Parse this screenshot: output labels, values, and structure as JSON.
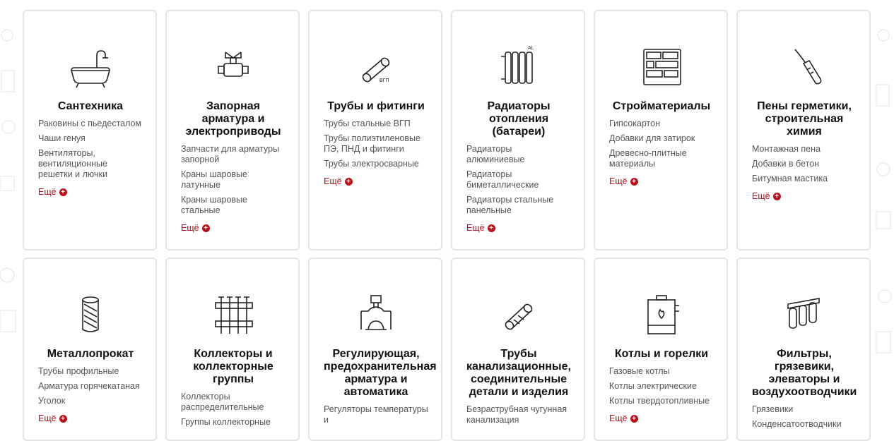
{
  "more_label": "Ещё",
  "accent_color": "#b5121b",
  "cards": [
    {
      "icon": "bathtub-icon",
      "title": "Сантехника",
      "links": [
        "Раковины с пьедесталом",
        "Чаши генуя",
        "Вентиляторы, вентиляционные решетки и лючки"
      ]
    },
    {
      "icon": "valve-icon",
      "title": "Запорная арматура и электроприводы",
      "links": [
        "Запчасти для арматуры запорной",
        "Краны шаровые латунные",
        "Краны шаровые стальные"
      ]
    },
    {
      "icon": "pipe-vgp-icon",
      "title": "Трубы и фитинги",
      "links": [
        "Трубы стальные ВГП",
        "Трубы полиэтиленовые ПЭ, ПНД и фитинги",
        "Трубы электросварные"
      ]
    },
    {
      "icon": "radiator-icon",
      "title": "Радиаторы отопления (батареи)",
      "links": [
        "Радиаторы алюминиевые",
        "Радиаторы биметаллические",
        "Радиаторы стальные панельные"
      ]
    },
    {
      "icon": "bricks-icon",
      "title": "Стройматериалы",
      "links": [
        "Гипсокартон",
        "Добавки для затирок",
        "Древесно-плитные материалы"
      ]
    },
    {
      "icon": "sealant-tube-icon",
      "title": "Пены герметики, строительная химия",
      "links": [
        "Монтажная пена",
        "Добавки в бетон",
        "Битумная мастика"
      ]
    },
    {
      "icon": "metal-roll-icon",
      "title": "Металлопрокат",
      "links": [
        "Трубы профильные",
        "Арматура горячекатаная",
        "Уголок"
      ]
    },
    {
      "icon": "manifold-icon",
      "title": "Коллекторы и коллекторные группы",
      "links": [
        "Коллекторы распределительные",
        "Группы коллекторные"
      ]
    },
    {
      "icon": "regulator-valve-icon",
      "title": "Регулирующая, предохранительная арматура и автоматика",
      "links": [
        "Регуляторы температуры и"
      ]
    },
    {
      "icon": "sewer-pipe-icon",
      "title": "Трубы канализационные, соединительные детали и изделия",
      "links": [
        "Безраструбная чугунная канализация"
      ]
    },
    {
      "icon": "boiler-icon",
      "title": "Котлы и горелки",
      "links": [
        "Газовые котлы",
        "Котлы электрические",
        "Котлы твердотопливные"
      ]
    },
    {
      "icon": "filter-icon",
      "title": "Фильтры, грязевики, элеваторы и воздухоотводчики",
      "links": [
        "Грязевики",
        "Конденсатоотводчики"
      ]
    }
  ]
}
